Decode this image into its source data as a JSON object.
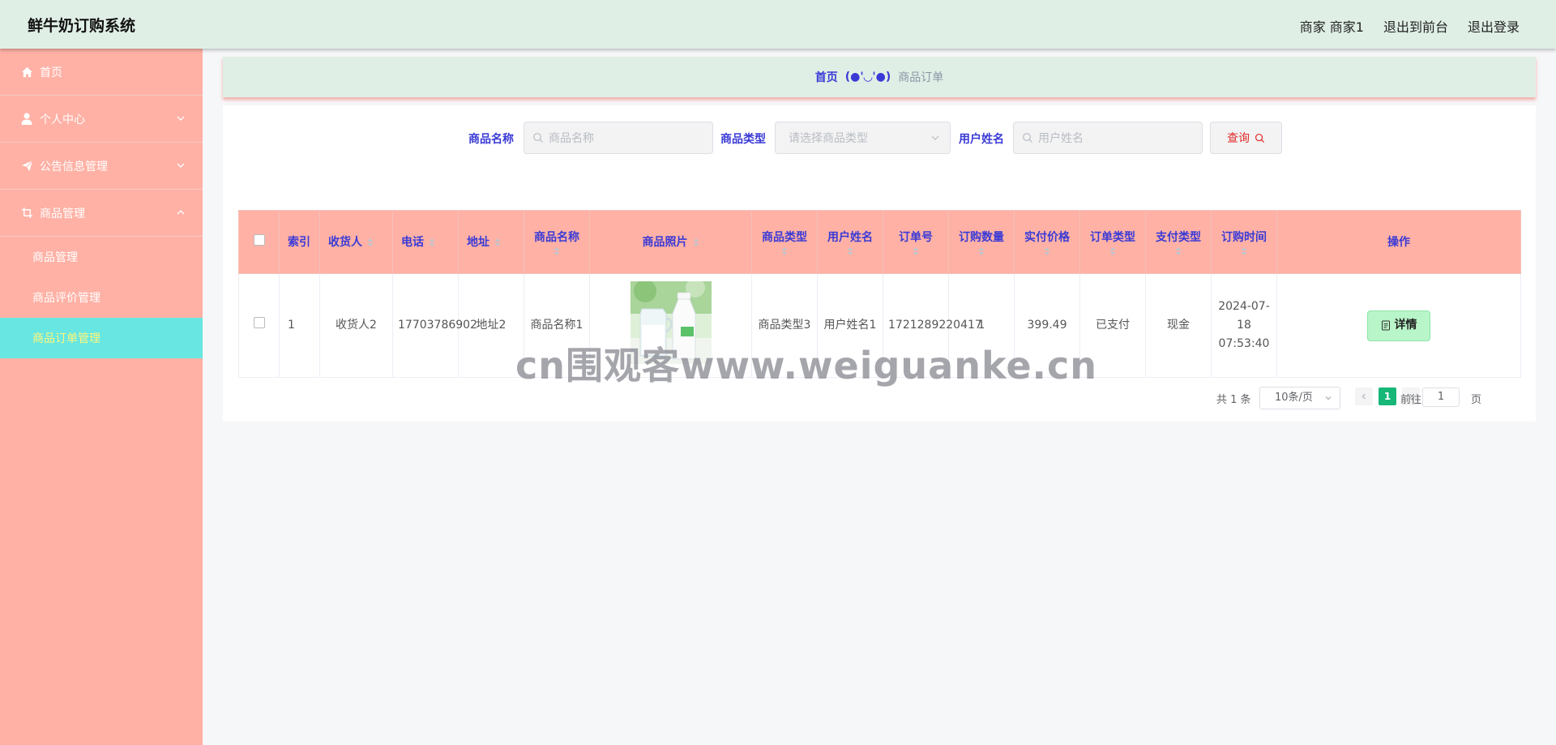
{
  "header": {
    "title": "鲜牛奶订购系统",
    "user": "商家 商家1",
    "to_front": "退出到前台",
    "logout": "退出登录"
  },
  "sidebar": {
    "items": [
      {
        "label": "首页",
        "icon": "home-icon"
      },
      {
        "label": "个人中心",
        "icon": "user-icon"
      },
      {
        "label": "公告信息管理",
        "icon": "send-icon"
      },
      {
        "label": "商品管理",
        "icon": "crop-icon"
      }
    ],
    "sub_items": [
      {
        "label": "商品管理"
      },
      {
        "label": "商品评价管理"
      },
      {
        "label": "商品订单管理"
      }
    ]
  },
  "breadcrumb": {
    "home": "首页",
    "separator": "(●'◡'●)",
    "current": "商品订单"
  },
  "search": {
    "product_name_label": "商品名称",
    "product_name_placeholder": "商品名称",
    "product_type_label": "商品类型",
    "product_type_placeholder": "请选择商品类型",
    "user_name_label": "用户姓名",
    "user_name_placeholder": "用户姓名",
    "query_label": "查询"
  },
  "table": {
    "columns": {
      "index": "索引",
      "receiver": "收货人",
      "phone": "电话",
      "address": "地址",
      "product_name": "商品名称",
      "product_photo": "商品照片",
      "product_type": "商品类型",
      "user_name": "用户姓名",
      "order_no": "订单号",
      "quantity": "订购数量",
      "paid_price": "实付价格",
      "order_type": "订单类型",
      "pay_type": "支付类型",
      "order_time": "订购时间",
      "actions": "操作"
    },
    "rows": [
      {
        "index": "1",
        "receiver": "收货人2",
        "phone": "17703786902",
        "address": "地址2",
        "product_name": "商品名称1",
        "product_type": "商品类型3",
        "user_name": "用户姓名1",
        "order_no": "1721289220417",
        "quantity": "1",
        "paid_price": "399.49",
        "order_type": "已支付",
        "pay_type": "现金",
        "order_time": "2024-07-18 07:53:40",
        "detail_label": "详情"
      }
    ]
  },
  "pagination": {
    "total": "共 1 条",
    "page_size": "10条/页",
    "current_page": "1",
    "goto_label": "前往",
    "goto_value": "1",
    "page_suffix": "页"
  },
  "watermark": "cn围观客www.weiguanke.cn",
  "colors": {
    "header_bg": "#e0efe6",
    "sidebar_bg": "#ffb1a5",
    "active_sub_bg": "#68e6e1",
    "active_sub_text": "#fff77a",
    "accent_blue": "#3a3ad6",
    "detail_btn_bg": "#b8f5c8",
    "pager_active": "#16b777"
  }
}
